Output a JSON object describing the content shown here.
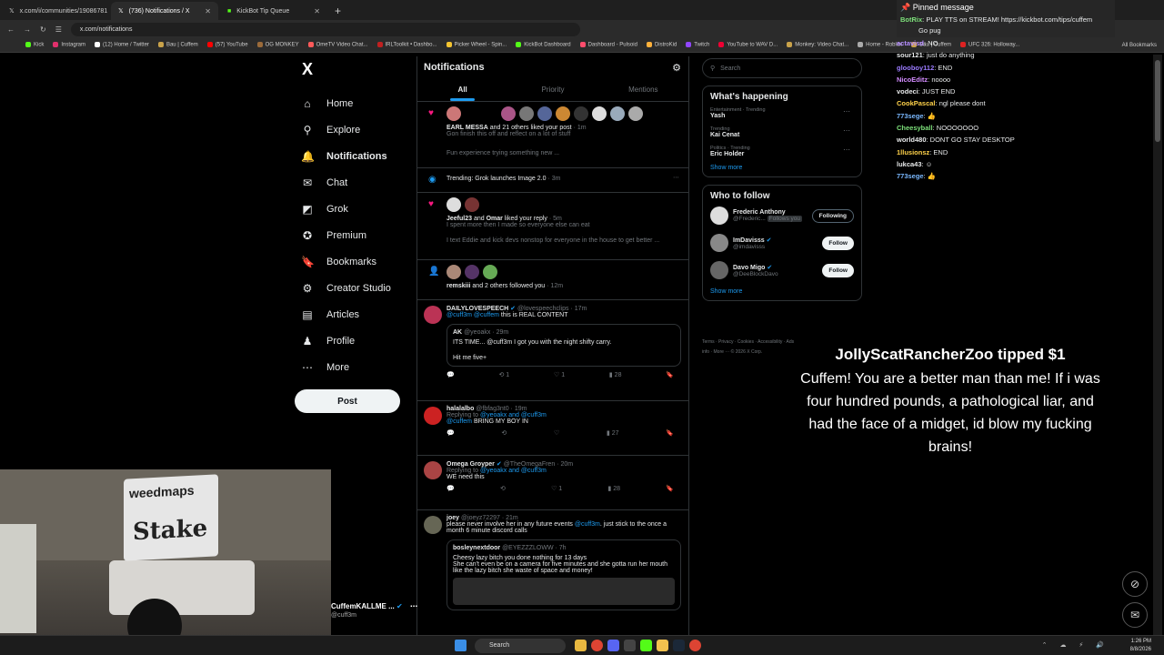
{
  "browser": {
    "tabs": [
      {
        "label": "x.com/i/communities/19086781",
        "active": false
      },
      {
        "label": "(736) Notifications / X",
        "active": true
      },
      {
        "label": "KickBot Tip Queue",
        "active": false
      }
    ],
    "url": "x.com/notifications",
    "bookmarks": [
      "Kick",
      "Instagram",
      "(12) Home / Twitter",
      "Bau | Cuffem",
      "(57) YouTube",
      "OG MONKEY",
      "OmeTV Video Chat...",
      "IRLToolkit • Dashbo...",
      "Picker Wheel - Spin...",
      "KickBot Dashboard",
      "Dashboard - Pulsoid",
      "DistroKid",
      "Twitch",
      "YouTube to WAV D...",
      "Monkey: Video Chat...",
      "Home - Roblox",
      "Bau | Cuffem",
      "UFC 326: Holloway..."
    ],
    "all_bookmarks": "All Bookmarks"
  },
  "xnav": {
    "logo": "X",
    "items": [
      {
        "label": "Home",
        "icon": "home-icon",
        "glyph": "⌂"
      },
      {
        "label": "Explore",
        "icon": "search-icon",
        "glyph": "⚲"
      },
      {
        "label": "Notifications",
        "icon": "bell-icon",
        "glyph": "🔔"
      },
      {
        "label": "Chat",
        "icon": "chat-icon",
        "glyph": "✉"
      },
      {
        "label": "Grok",
        "icon": "grok-icon",
        "glyph": "◩"
      },
      {
        "label": "Premium",
        "icon": "premium-icon",
        "glyph": "✪"
      },
      {
        "label": "Bookmarks",
        "icon": "bookmark-icon",
        "glyph": "🔖"
      },
      {
        "label": "Creator Studio",
        "icon": "creator-icon",
        "glyph": "⚙"
      },
      {
        "label": "Articles",
        "icon": "article-icon",
        "glyph": "▤"
      },
      {
        "label": "Profile",
        "icon": "profile-icon",
        "glyph": "♟"
      },
      {
        "label": "More",
        "icon": "more-icon",
        "glyph": "⋯"
      }
    ],
    "post": "Post"
  },
  "feed": {
    "title": "Notifications",
    "tabs": [
      "All",
      "Priority",
      "Mentions"
    ],
    "like1": {
      "who": "EARL MESSA",
      "rest": " and 21 others liked your post",
      "time": " · 1m",
      "l1": "Gon finish this off and reflect on a lot of stuff",
      "l2": "Fun experience trying something new ..."
    },
    "trending": {
      "text": "Trending: Grok launches Image 2.0",
      "time": " · 3m"
    },
    "like2": {
      "who": "Jeeful23",
      "and": " and ",
      "who2": "Omar",
      "rest": " liked your reply",
      "time": " · 5m",
      "l1": "I spent more then I made so everyone else can eat",
      "l2": "I text Eddie and kick devs nonstop for everyone in the house to get better ..."
    },
    "follow": {
      "who": "remskiii",
      "rest": " and 2 others followed you",
      "time": " · 12m"
    },
    "tweet1": {
      "name": "DAILYLOVESPEECH",
      "handle": "@lovespeechclips · 17m",
      "mention": "@cuff3m @cuffem",
      "text": " this is REAL CONTENT",
      "qname": "AK",
      "qhandle": "@yeoakx · 29m",
      "q1": "ITS TIME... @cuff3m I got you with the night shifty carry.",
      "q2": "Hit me five+",
      "retweets": "1",
      "likes": "1",
      "views": "28"
    },
    "tweet2": {
      "name": "halalalbo",
      "handle": "@fbfag3nt0 · 19m",
      "replying": "Replying to ",
      "replyto": "@yeoakx and @cuff3m",
      "mention": "@cuffem",
      "text": " BRING MY BOY IN",
      "views": "27"
    },
    "tweet3": {
      "name": "Omega Groyper",
      "handle": "@TheOmegaFren · 20m",
      "replying": "Replying to ",
      "replyto": "@yeoakx and @cuff3m",
      "text": "WE need this",
      "likes": "1",
      "views": "28"
    },
    "tweet4": {
      "name": "joey",
      "handle": "@joeyz72297 · 21m",
      "t1": "please never involve her in any future events ",
      "mention": "@cuff3m",
      "t2": ". just stick to the once a month 6 minute discord calls",
      "qname": "bosleynextdoor",
      "qhandle": "@EYEZZZLOWW · 7h",
      "q1": "Cheesy lazy bitch you done nothing for 13 days",
      "q2": "She can't even be on a camera for five minutes and she gotta run her mouth like the lazy bitch she waste of space and money!"
    }
  },
  "side": {
    "search": "Search",
    "happening_title": "What's happening",
    "trends": [
      {
        "cat": "Entertainment · Trending",
        "name": "Yash"
      },
      {
        "cat": "Trending",
        "name": "Kai Cenat"
      },
      {
        "cat": "Politics · Trending",
        "name": "Eric Holder"
      }
    ],
    "show_more": "Show more",
    "wtf_title": "Who to follow",
    "follows": [
      {
        "name": "Frederic Anthony",
        "handle": "@Frederic...",
        "btn": "Following",
        "extra": "Follows you"
      },
      {
        "name": "ImDavisss",
        "handle": "@imdavisss",
        "btn": "Follow",
        "extra": ""
      },
      {
        "name": "Davo Migo",
        "handle": "@DeeBlockDavo",
        "btn": "Follow",
        "extra": ""
      }
    ],
    "show_more2": "Show more",
    "footer": "Terms · Privacy · Cookies · Accessibility · Ads info · More ··· © 2026 X Corp."
  },
  "chat": {
    "pinned_label": "Pinned message",
    "pinned_user": "BotRix",
    "pinned_text": ": PLAY TTS on STREAM! https://kickbot.com/tips/cuffem",
    "top_line": "Go pug",
    "messages": [
      {
        "user": "actavisd",
        "text": ": NO",
        "color": "#b58cff"
      },
      {
        "user": "sour121",
        "text": ": just do anything",
        "color": "#e7e9ea"
      },
      {
        "user": "glooboy112",
        "text": ": END",
        "color": "#9b7bff"
      },
      {
        "user": "NicoEditz",
        "text": ": noooo",
        "color": "#d48cff"
      },
      {
        "user": "vodeci",
        "text": ": JUST END",
        "color": "#e7e9ea"
      },
      {
        "user": "CookPascal",
        "text": ": ngl please dont",
        "color": "#ffd24a"
      },
      {
        "user": "773sege",
        "text": ": 👍",
        "color": "#7ab8ff"
      },
      {
        "user": "Cheesyball",
        "text": ": NOOOOOOO",
        "color": "#7de07a"
      },
      {
        "user": "world480",
        "text": ": DONT GO STAY DESKTOP",
        "color": "#e7e9ea"
      },
      {
        "user": "1llusionsz",
        "text": ": END",
        "color": "#ffd24a"
      },
      {
        "user": "lukca43",
        "text": ": ☺",
        "color": "#e7e9ea"
      },
      {
        "user": "773sege",
        "text": ": 👍",
        "color": "#7ab8ff"
      }
    ]
  },
  "tip": {
    "title": "JollyScatRancherZoo tipped $1",
    "body": "Cuffem! You are a better man than me! If i was four hundred pounds, a pathological liar, and had the face of a midget, id blow my fucking brains!"
  },
  "webcam": {
    "banner_top": "weedmaps",
    "banner_main": "Stake"
  },
  "streamer": {
    "name": "CuffemKALLME ...",
    "handle": "@cuff3m"
  },
  "taskbar": {
    "search": "Search",
    "time": "1:26 PM",
    "date": "8/8/2026"
  }
}
